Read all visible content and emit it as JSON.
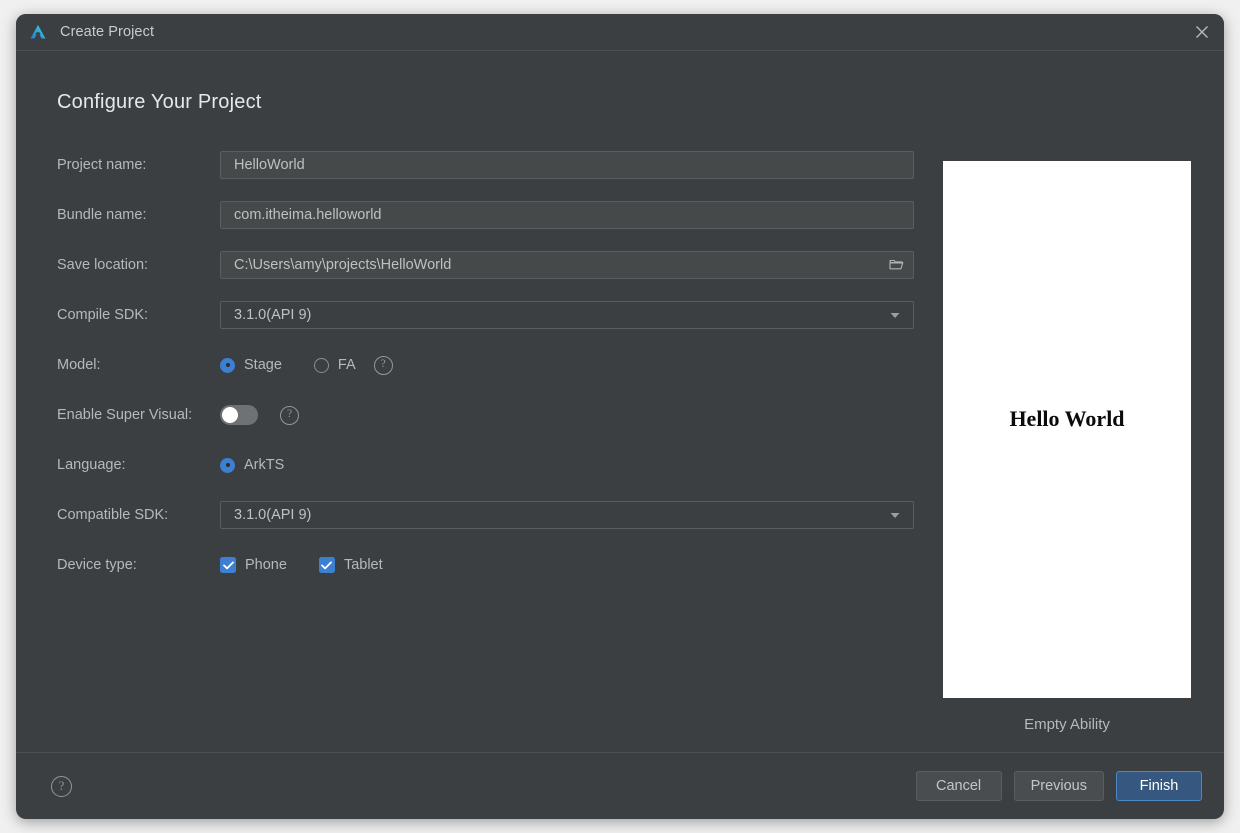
{
  "window": {
    "title": "Create Project",
    "logo_icon": "deveco-logo-icon",
    "close_icon": "close-icon"
  },
  "page": {
    "heading": "Configure Your Project"
  },
  "form": {
    "project_name": {
      "label": "Project name:",
      "value": "HelloWorld",
      "placeholder": "Project name"
    },
    "bundle_name": {
      "label": "Bundle name:",
      "value": "com.itheima.helloworld",
      "placeholder": "Bundle name"
    },
    "save_location": {
      "label": "Save location:",
      "value": "C:\\Users\\amy\\projects\\HelloWorld",
      "placeholder": "Save location",
      "browse_icon": "folder-open-icon"
    },
    "compile_sdk": {
      "label": "Compile SDK:",
      "value": "3.1.0(API 9)",
      "arrow_icon": "chevron-down-icon"
    },
    "model": {
      "label": "Model:",
      "options": [
        {
          "label": "Stage",
          "selected": true
        },
        {
          "label": "FA",
          "selected": false
        }
      ],
      "help_icon": "help-icon",
      "help_label": "?"
    },
    "enable_super_visual": {
      "label": "Enable Super Visual:",
      "state": "off",
      "help_icon": "help-icon",
      "help_label": "?"
    },
    "language": {
      "label": "Language:",
      "options": [
        {
          "label": "ArkTS",
          "selected": true
        }
      ]
    },
    "compatible_sdk": {
      "label": "Compatible SDK:",
      "value": "3.1.0(API 9)",
      "arrow_icon": "chevron-down-icon"
    },
    "device_type": {
      "label": "Device type:",
      "options": [
        {
          "label": "Phone",
          "checked": true
        },
        {
          "label": "Tablet",
          "checked": true
        }
      ]
    }
  },
  "preview": {
    "screen_text": "Hello World",
    "caption": "Empty Ability"
  },
  "footer": {
    "help_label": "?",
    "help_icon": "help-icon",
    "cancel_label": "Cancel",
    "previous_label": "Previous",
    "finish_label": "Finish"
  },
  "colors": {
    "dialog_bg": "#3c3f41",
    "field_bg": "#45494a",
    "accent": "#3d7fd0",
    "primary_button_bg": "#365880",
    "primary_button_border": "#4a88c7",
    "text": "#b6b9bb",
    "page_bg": "#f0f0f0"
  }
}
